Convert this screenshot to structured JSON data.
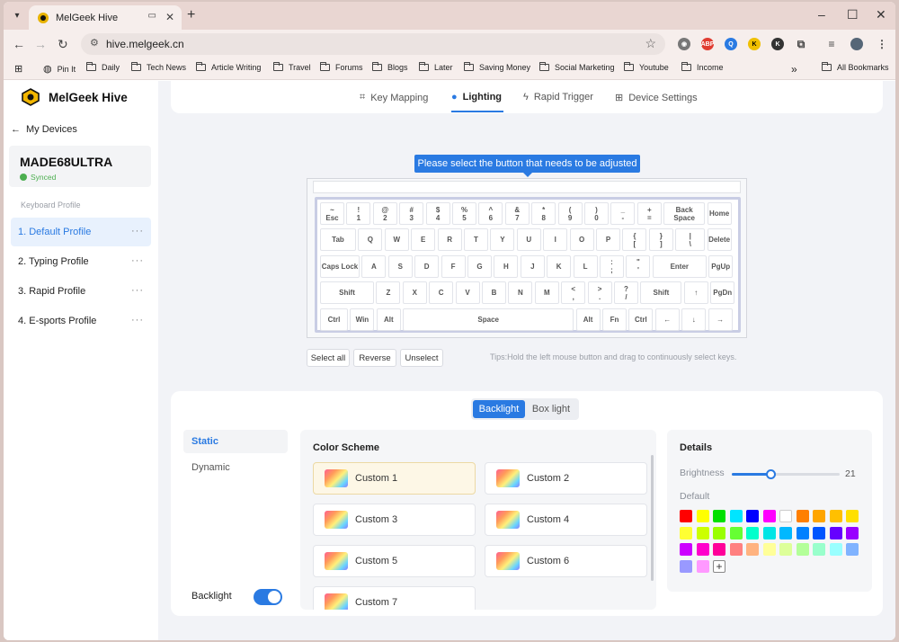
{
  "browser": {
    "tab_title": "MelGeek Hive",
    "url": "hive.melgeek.cn",
    "new_tab": "+",
    "bookmarks": [
      "Pin It",
      "Daily",
      "Tech News",
      "Article Writing",
      "Travel",
      "Forums",
      "Blogs",
      "Later",
      "Saving Money",
      "Social Marketing",
      "Youtube",
      "Income"
    ],
    "all_bookmarks": "All Bookmarks",
    "overflow": "»"
  },
  "app": {
    "name": "MelGeek Hive",
    "back_label": "My Devices",
    "device_name": "MADE68ULTRA",
    "device_status": "Synced",
    "profile_section": "Keyboard Profile",
    "profiles": [
      {
        "label": "1. Default Profile",
        "active": true
      },
      {
        "label": "2. Typing Profile",
        "active": false
      },
      {
        "label": "3. Rapid Profile",
        "active": false
      },
      {
        "label": "4. E-sports Profile",
        "active": false
      }
    ],
    "more": "···"
  },
  "nav": {
    "tabs": [
      {
        "label": "Key Mapping",
        "icon": "grid-icon",
        "active": false
      },
      {
        "label": "Lighting",
        "icon": "bulb-icon",
        "active": true
      },
      {
        "label": "Rapid Trigger",
        "icon": "bolt-icon",
        "active": false
      },
      {
        "label": "Device Settings",
        "icon": "sliders-icon",
        "active": false
      }
    ]
  },
  "keyboard": {
    "prompt": "Please select the button that needs to be adjusted",
    "rows": [
      [
        [
          "~",
          "Esc"
        ],
        [
          "!",
          "1"
        ],
        [
          "@",
          "2"
        ],
        [
          "#",
          "3"
        ],
        [
          "$",
          "4"
        ],
        [
          "%",
          "5"
        ],
        [
          "^",
          "6"
        ],
        [
          "&",
          "7"
        ],
        [
          "*",
          "8"
        ],
        [
          "(",
          "9"
        ],
        [
          ")",
          "0"
        ],
        [
          "_",
          "-"
        ],
        [
          "+",
          "="
        ],
        [
          "Back Space"
        ],
        [
          "Home"
        ]
      ],
      [
        [
          "Tab"
        ],
        [
          "Q"
        ],
        [
          "W"
        ],
        [
          "E"
        ],
        [
          "R"
        ],
        [
          "T"
        ],
        [
          "Y"
        ],
        [
          "U"
        ],
        [
          "I"
        ],
        [
          "O"
        ],
        [
          "P"
        ],
        [
          "{",
          "["
        ],
        [
          "}",
          "]"
        ],
        [
          "|",
          "\\"
        ],
        [
          "Delete"
        ]
      ],
      [
        [
          "Caps Lock"
        ],
        [
          "A"
        ],
        [
          "S"
        ],
        [
          "D"
        ],
        [
          "F"
        ],
        [
          "G"
        ],
        [
          "H"
        ],
        [
          "J"
        ],
        [
          "K"
        ],
        [
          "L"
        ],
        [
          ":",
          ";"
        ],
        [
          "\"",
          "'"
        ],
        [
          "Enter"
        ],
        [
          "PgUp"
        ]
      ],
      [
        [
          "Shift"
        ],
        [
          "Z"
        ],
        [
          "X"
        ],
        [
          "C"
        ],
        [
          "V"
        ],
        [
          "B"
        ],
        [
          "N"
        ],
        [
          "M"
        ],
        [
          "<",
          ","
        ],
        [
          ">",
          "."
        ],
        [
          "?",
          "/"
        ],
        [
          "Shift"
        ],
        [
          "↑"
        ],
        [
          "PgDn"
        ]
      ],
      [
        [
          "Ctrl"
        ],
        [
          "Win"
        ],
        [
          "Alt"
        ],
        [
          "Space"
        ],
        [
          "Alt"
        ],
        [
          "Fn"
        ],
        [
          "Ctrl"
        ],
        [
          "←"
        ],
        [
          "↓"
        ],
        [
          "→"
        ]
      ]
    ],
    "buttons": {
      "select_all": "Select all",
      "reverse": "Reverse",
      "unselect": "Unselect"
    },
    "tips": "Tips:Hold the left mouse button and drag to continuously select keys."
  },
  "lighting": {
    "segments": [
      {
        "label": "Backlight",
        "active": true
      },
      {
        "label": "Box light",
        "active": false
      }
    ],
    "modes": [
      {
        "label": "Static",
        "active": true
      },
      {
        "label": "Dynamic",
        "active": false
      }
    ],
    "backlight_label": "Backlight",
    "backlight_on": true,
    "color_scheme_title": "Color Scheme",
    "schemes": [
      {
        "label": "Custom 1",
        "active": true
      },
      {
        "label": "Custom 2",
        "active": false
      },
      {
        "label": "Custom 3",
        "active": false
      },
      {
        "label": "Custom 4",
        "active": false
      },
      {
        "label": "Custom 5",
        "active": false
      },
      {
        "label": "Custom 6",
        "active": false
      },
      {
        "label": "Custom 7",
        "active": false
      }
    ],
    "details_title": "Details",
    "brightness_label": "Brightness",
    "brightness_value": "21",
    "brightness_fraction": 0.36,
    "default_label": "Default",
    "add_label": "+",
    "colors": [
      "#ff0000",
      "#ffff00",
      "#00e000",
      "#00e5ff",
      "#0000ff",
      "#ff00ff",
      "#ffffff",
      "#ff7f00",
      "#ffa500",
      "#ffc000",
      "#ffe000",
      "#ffff33",
      "#ccff00",
      "#99ff00",
      "#66ff33",
      "#00ffcc",
      "#00e5e5",
      "#00b8ff",
      "#0080ff",
      "#0055ff",
      "#6600ff",
      "#9900ff",
      "#cc00ff",
      "#ff00cc",
      "#ff0099",
      "#ff8080",
      "#ffb380",
      "#ffff99",
      "#ddff99",
      "#b3ff99",
      "#99ffcc",
      "#99ffff",
      "#80b3ff",
      "#9999ff",
      "#ff99ff"
    ]
  }
}
